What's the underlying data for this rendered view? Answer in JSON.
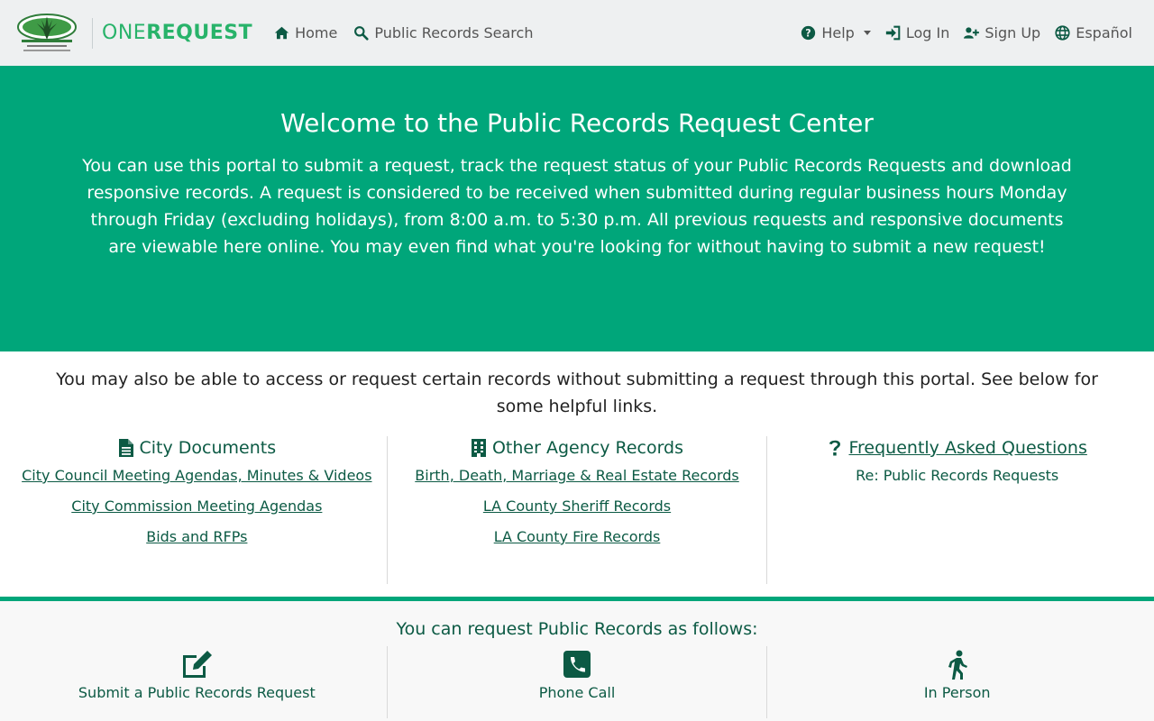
{
  "navbar": {
    "brand_one": "ONE",
    "brand_request": "REQUEST",
    "home": "Home",
    "search": "Public Records Search",
    "help": "Help",
    "login": "Log In",
    "signup": "Sign Up",
    "language": "Español"
  },
  "hero": {
    "title": "Welcome to the Public Records Request Center",
    "body": "You can use this portal to submit a request, track the request status of your Public Records Requests and download responsive records. A request is considered to be received when submitted during regular business hours Monday through Friday (excluding holidays), from 8:00 a.m. to 5:30 p.m. All previous requests and responsive documents are viewable here online. You may even find what you're looking for without having to submit a new request!"
  },
  "info": {
    "text": "You may also be able to access or request certain records without submitting a request through this portal. See below for some helpful links."
  },
  "columns": {
    "city": {
      "title": "City Documents",
      "links": [
        "City Council Meeting Agendas, Minutes & Videos",
        "City Commission Meeting Agendas",
        "Bids and RFPs"
      ]
    },
    "agency": {
      "title": "Other Agency Records",
      "links": [
        "Birth, Death, Marriage & Real Estate Records",
        "LA County Sheriff Records",
        "LA County Fire Records"
      ]
    },
    "faq": {
      "title": "Frequently Asked Questions",
      "sub": "Re: Public Records Requests"
    }
  },
  "methods": {
    "title": "You can request Public Records as follows:",
    "items": [
      "Submit a Public Records Request",
      "Phone Call",
      "In Person"
    ]
  },
  "colors": {
    "accent": "#00a67a",
    "dark_green": "#0c5a44",
    "brand_green": "#28b36a"
  }
}
